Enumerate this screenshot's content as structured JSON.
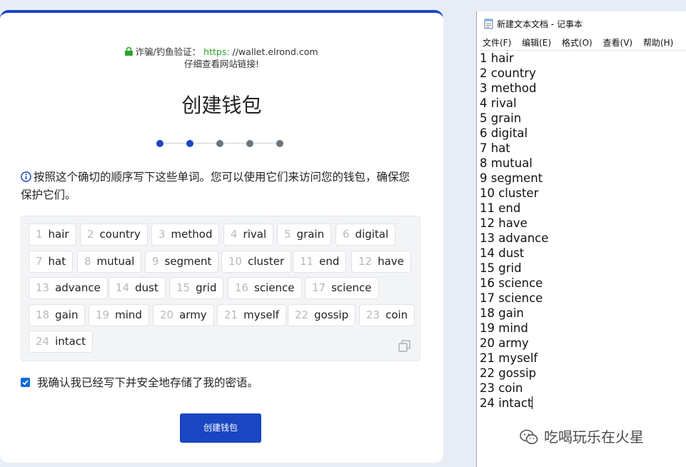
{
  "wallet": {
    "verify_label": "诈骗/钓鱼验证：",
    "url_scheme": "https:",
    "url_rest": " //wallet.elrond.com",
    "verify_hint": "仔细查看网站链接!",
    "title": "创建钱包",
    "steps_total": 5,
    "steps_active": 2,
    "instruction": "按照这个确切的顺序写下这些单词。您可以使用它们来访问您的钱包，确保您保护它们。",
    "words": [
      {
        "n": "1",
        "w": "hair"
      },
      {
        "n": "2",
        "w": "country"
      },
      {
        "n": "3",
        "w": "method"
      },
      {
        "n": "4",
        "w": "rival"
      },
      {
        "n": "5",
        "w": "grain"
      },
      {
        "n": "6",
        "w": "digital"
      },
      {
        "n": "7",
        "w": "hat"
      },
      {
        "n": "8",
        "w": "mutual"
      },
      {
        "n": "9",
        "w": "segment"
      },
      {
        "n": "10",
        "w": "cluster"
      },
      {
        "n": "11",
        "w": "end"
      },
      {
        "n": "12",
        "w": "have"
      },
      {
        "n": "13",
        "w": "advance"
      },
      {
        "n": "14",
        "w": "dust"
      },
      {
        "n": "15",
        "w": "grid"
      },
      {
        "n": "16",
        "w": "science"
      },
      {
        "n": "17",
        "w": "science"
      },
      {
        "n": "18",
        "w": "gain"
      },
      {
        "n": "19",
        "w": "mind"
      },
      {
        "n": "20",
        "w": "army"
      },
      {
        "n": "21",
        "w": "myself"
      },
      {
        "n": "22",
        "w": "gossip"
      },
      {
        "n": "23",
        "w": "coin"
      },
      {
        "n": "24",
        "w": "intact"
      }
    ],
    "confirm_label": "我确认我已经写下并安全地存储了我的密语。",
    "confirm_checked": true,
    "create_button": "创建钱包",
    "accent_color": "#1b46c2"
  },
  "notepad": {
    "title": "新建文本文档 - 记事本",
    "menu": [
      "文件(F)",
      "编辑(E)",
      "格式(O)",
      "查看(V)",
      "帮助(H)"
    ],
    "lines": [
      "1 hair",
      "2 country",
      "3 method",
      "4 rival",
      "5 grain",
      "6 digital",
      "7 hat",
      "8 mutual",
      "9 segment",
      "10 cluster",
      "11 end",
      "12 have",
      "13 advance",
      "14 dust",
      "15 grid",
      "16 science",
      "17 science",
      "18 gain",
      "19 mind",
      "20 army",
      "21 myself",
      "22 gossip",
      "23 coin",
      "24 intact"
    ]
  },
  "watermark": "吃喝玩乐在火星"
}
